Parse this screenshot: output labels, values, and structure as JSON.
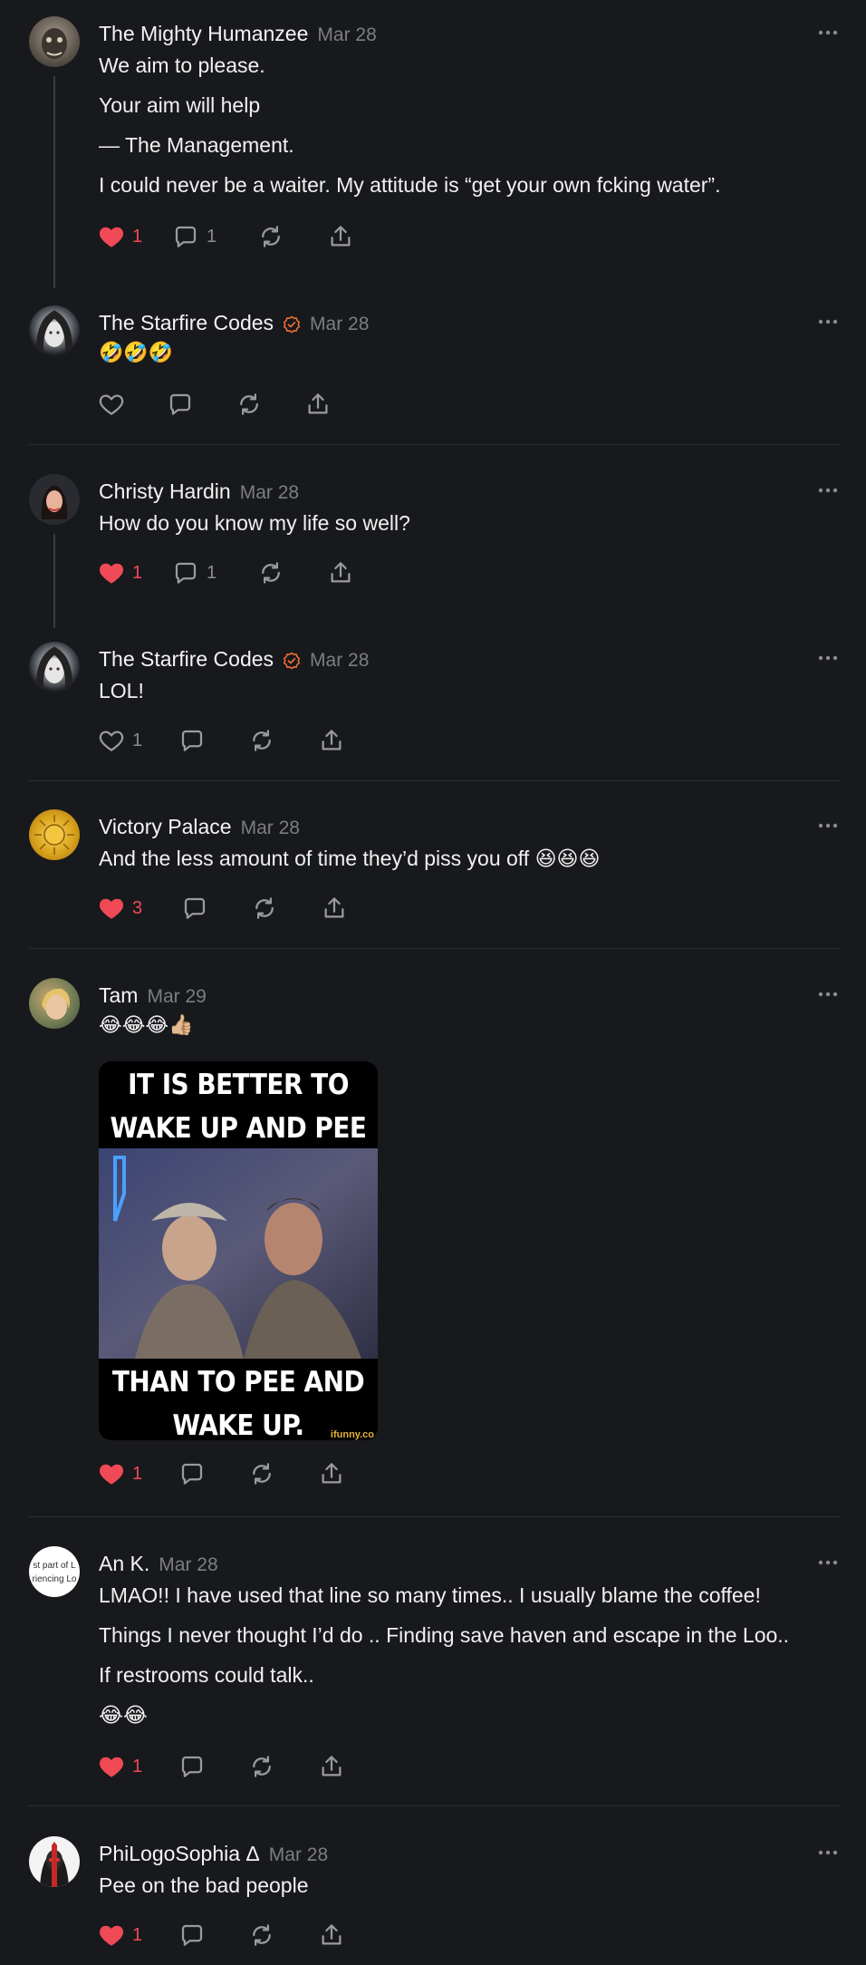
{
  "posts": [
    {
      "author": "The Mighty Humanzee",
      "date": "Mar 28",
      "lines": [
        "We aim to please.",
        "Your aim will help",
        "— The Management.",
        "I could never be a waiter. My attitude is “get your own fcking water”."
      ],
      "likes": "1",
      "comments": "1"
    },
    {
      "author": "The Starfire Codes",
      "date": "Mar 28",
      "emoji": "🤣🤣🤣"
    },
    {
      "author": "Christy Hardin",
      "date": "Mar 28",
      "text": "How do you know my life so well?",
      "likes": "1",
      "comments": "1"
    },
    {
      "author": "The Starfire Codes",
      "date": "Mar 28",
      "text": "LOL!",
      "likes": "1"
    },
    {
      "author": "Victory Palace",
      "date": "Mar 28",
      "text": "And the less amount of time they’d piss you off",
      "emoji": "😆😆😆",
      "likes": "3"
    },
    {
      "author": "Tam",
      "date": "Mar 29",
      "emoji": "😂😂😂👍🏼",
      "likes": "1",
      "meme": {
        "top": "IT IS BETTER TO WAKE UP AND PEE",
        "bottom": "THAN TO PEE AND WAKE UP.",
        "watermark": "ifunny.co"
      }
    },
    {
      "author": "An K.",
      "date": "Mar 28",
      "avatar_text": "st part of L riencing Lo",
      "lines": [
        "LMAO!! I have used that line so many times.. I usually blame the coffee!",
        "Things I never thought I’d do .. Finding save haven and escape in the Loo..",
        "If restrooms could talk.."
      ],
      "emoji": "😂😂",
      "likes": "1"
    },
    {
      "author": "PhiLogoSophia Δ",
      "date": "Mar 28",
      "text": "Pee on the bad people",
      "likes": "1"
    }
  ],
  "colors": {
    "background": "#18191c",
    "liked": "#ef4a56",
    "verified": "#ee7033",
    "muted": "#8b8c91"
  },
  "icons": [
    "heart-icon",
    "comment-icon",
    "repost-icon",
    "share-icon",
    "more-icon",
    "verified-icon"
  ]
}
